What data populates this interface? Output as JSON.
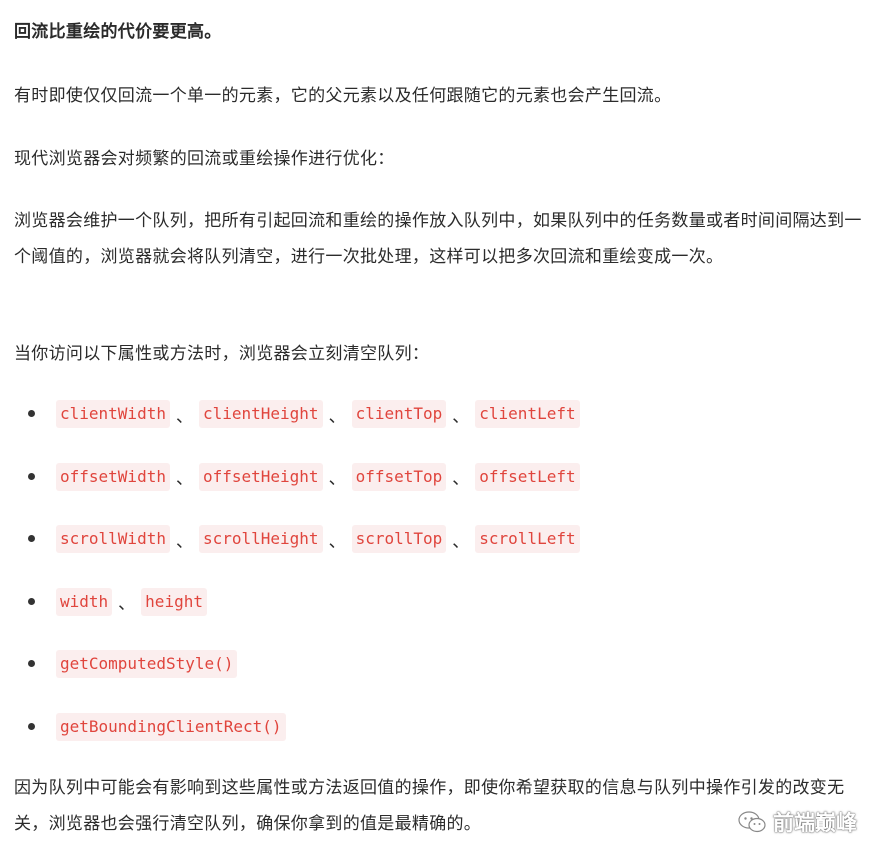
{
  "article": {
    "heading": "回流比重绘的代价要更高。",
    "p1": "有时即使仅仅回流一个单一的元素，它的父元素以及任何跟随它的元素也会产生回流。",
    "p2": "现代浏览器会对频繁的回流或重绘操作进行优化：",
    "p3": "浏览器会维护一个队列，把所有引起回流和重绘的操作放入队列中，如果队列中的任务数量或者时间间隔达到一个阈值的，浏览器就会将队列清空，进行一次批处理，这样可以把多次回流和重绘变成一次。",
    "p4": "当你访问以下属性或方法时，浏览器会立刻清空队列：",
    "separator": "、",
    "list": [
      [
        "clientWidth",
        "clientHeight",
        "clientTop",
        "clientLeft"
      ],
      [
        "offsetWidth",
        "offsetHeight",
        "offsetTop",
        "offsetLeft"
      ],
      [
        "scrollWidth",
        "scrollHeight",
        "scrollTop",
        "scrollLeft"
      ],
      [
        "width",
        "height"
      ],
      [
        "getComputedStyle()"
      ],
      [
        "getBoundingClientRect()"
      ]
    ],
    "p5": "因为队列中可能会有影响到这些属性或方法返回值的操作，即使你希望获取的信息与队列中操作引发的改变无关，浏览器也会强行清空队列，确保你拿到的值是最精确的。"
  },
  "watermark": {
    "text": "前端巅峰",
    "icon": "wechat-icon"
  },
  "colors": {
    "code_text": "#e0453d",
    "code_bg": "#fbeeee",
    "body_text": "#2b2b2b"
  }
}
